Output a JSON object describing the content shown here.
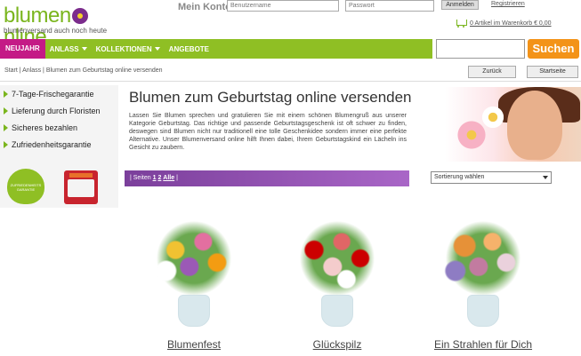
{
  "header": {
    "logo_text_left": "blumen",
    "logo_text_right": "nline",
    "logo_tagline": "blumenversand auch      noch heute",
    "account_label": "Mein Konto",
    "username_placeholder": "Benutzername",
    "password_placeholder": "Passwort",
    "login_label": "Anmelden",
    "register_label": "Registrieren",
    "cart_text": "0 Artikel im Warenkorb € 0,00"
  },
  "nav": {
    "new_label": "NEUJAHR",
    "items": [
      "ANLASS",
      "KOLLEKTIONEN",
      "ANGEBOTE"
    ],
    "search_label": "Suchen"
  },
  "breadcrumb": {
    "path": "Start | Anlass | Blumen zum Geburtstag online versenden",
    "back_label": "Zurück",
    "home_label": "Startseite"
  },
  "sidebar": {
    "usps": [
      "7-Tage-Frischegarantie",
      "Lieferung durch Floristen",
      "Sicheres bezahlen",
      "Zufriedenheitsgarantie"
    ],
    "badge_leaf_text": "ZUFRIEDENHEITS GARANTIE"
  },
  "main": {
    "title": "Blumen zum Geburtstag online versenden",
    "intro": "Lassen Sie Blumen sprechen und gratulieren Sie mit einem schönen Blumengruß aus unserer Kategorie Geburtstag. Das richtige und passende Geburtstagsgeschenk ist oft schwer zu finden, deswegen sind Blumen nicht nur traditionell eine tolle Geschenkidee sondern immer eine perfekte Alternative. Unser Blumenversand online hilft Ihnen dabei, Ihrem Geburtstagskind ein Lächeln ins Gesicht zu zaubern.",
    "pager_prefix": "| Seiten",
    "pager_page1": "1",
    "pager_page2": "2",
    "pager_all": "Alle",
    "pager_suffix": "|",
    "sort_label": "Sortierung wählen"
  },
  "products": [
    {
      "name": "Blumenfest"
    },
    {
      "name": "Glückspilz"
    },
    {
      "name": "Ein Strahlen für Dich"
    }
  ],
  "colors": {
    "brand_green": "#8fbf24",
    "brand_magenta": "#c41a86",
    "search_orange": "#f39318",
    "pager_purple": "#7b3f9b"
  }
}
